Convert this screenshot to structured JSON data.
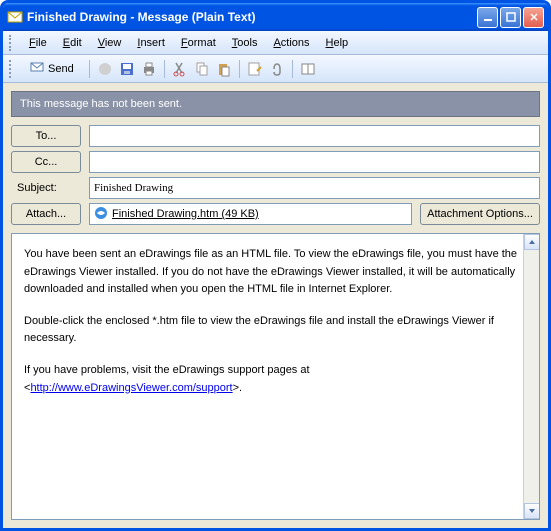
{
  "window": {
    "title": "Finished Drawing - Message (Plain Text)"
  },
  "menu": {
    "file": "File",
    "edit": "Edit",
    "view": "View",
    "insert": "Insert",
    "format": "Format",
    "tools": "Tools",
    "actions": "Actions",
    "help": "Help"
  },
  "toolbar": {
    "send_label": "Send"
  },
  "notice": "This message has not been sent.",
  "fields": {
    "to_label": "To...",
    "to_value": "",
    "cc_label": "Cc...",
    "cc_value": "",
    "subject_label": "Subject:",
    "subject_value": "Finished Drawing",
    "attach_label": "Attach...",
    "attach_filename": "Finished Drawing.htm (49 KB)",
    "attach_options_label": "Attachment Options..."
  },
  "body": {
    "p1": "You have been sent an eDrawings file as an HTML file. To view the eDrawings file, you must have the eDrawings Viewer installed. If you do not have the eDrawings Viewer installed, it will be automatically downloaded and installed when you open the HTML file in Internet Explorer.",
    "p2": "Double-click the enclosed *.htm file to view the eDrawings file and install the eDrawings Viewer if necessary.",
    "p3_prefix": "If you have problems, visit the eDrawings support pages at <",
    "p3_link": "http://www.eDrawingsViewer.com/support",
    "p3_suffix": ">."
  }
}
